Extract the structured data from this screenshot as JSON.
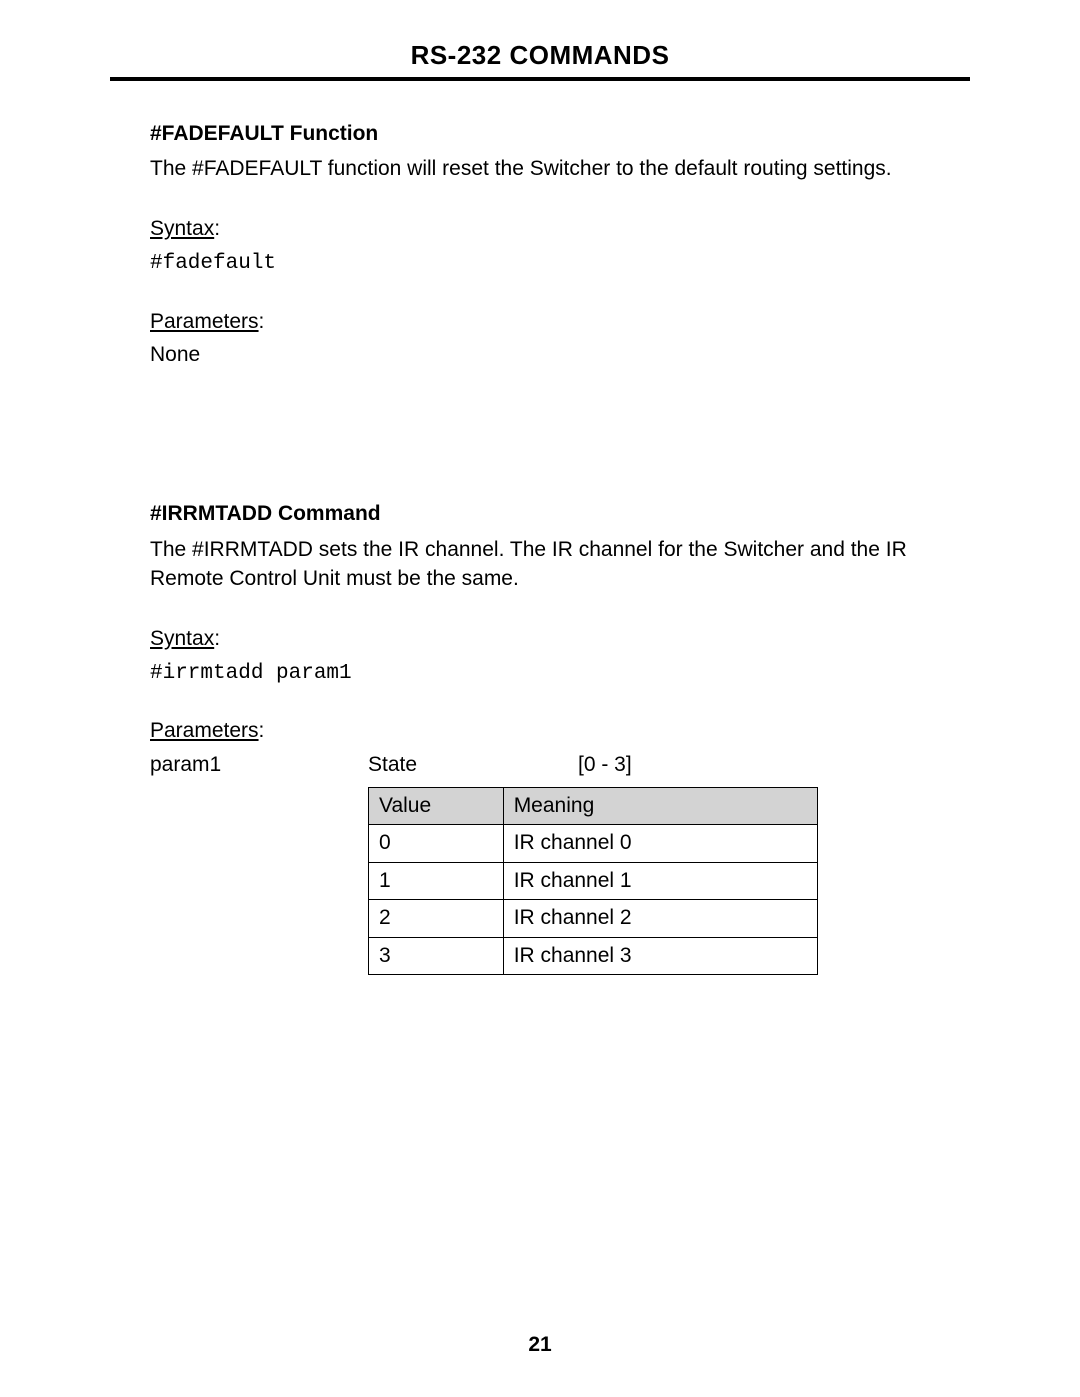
{
  "header": {
    "title": "RS-232 COMMANDS"
  },
  "section1": {
    "title": "#FADEFAULT Function",
    "description": "The #FADEFAULT function will reset the Switcher to the default routing settings.",
    "syntax_label": "Syntax",
    "syntax_code": "#fadefault",
    "parameters_label": "Parameters",
    "parameters_value": "None"
  },
  "section2": {
    "title": "#IRRMTADD Command",
    "description": "The #IRRMTADD sets the IR channel.  The IR channel for the Switcher and the IR Remote Control Unit must be the same.",
    "syntax_label": "Syntax",
    "syntax_code": "#irrmtadd param1",
    "parameters_label": "Parameters",
    "param_name": "param1",
    "param_type": "State",
    "param_range": "[0 - 3]",
    "table": {
      "headers": [
        "Value",
        "Meaning"
      ],
      "rows": [
        [
          "0",
          "IR channel 0"
        ],
        [
          "1",
          "IR channel 1"
        ],
        [
          "2",
          "IR channel 2"
        ],
        [
          "3",
          "IR channel 3"
        ]
      ]
    }
  },
  "footer": {
    "page_number": "21"
  }
}
